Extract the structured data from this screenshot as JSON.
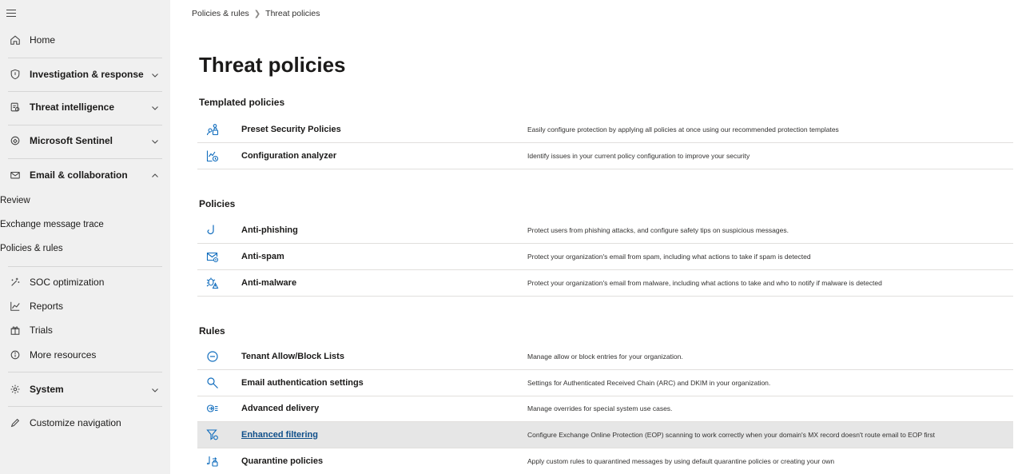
{
  "sidebar": {
    "items": [
      {
        "label": "Home",
        "icon": "home-icon"
      },
      {
        "label": "Investigation & response",
        "icon": "shield-icon"
      },
      {
        "label": "Threat intelligence",
        "icon": "threat-intel-icon"
      },
      {
        "label": "Microsoft Sentinel",
        "icon": "sentinel-icon"
      },
      {
        "label": "Email & collaboration",
        "icon": "mail-icon"
      },
      {
        "label": "SOC optimization",
        "icon": "soc-optimization-icon"
      },
      {
        "label": "Reports",
        "icon": "chart-icon"
      },
      {
        "label": "Trials",
        "icon": "gift-icon"
      },
      {
        "label": "More resources",
        "icon": "info-icon"
      },
      {
        "label": "System",
        "icon": "gear-icon"
      },
      {
        "label": "Customize navigation",
        "icon": "pencil-icon"
      }
    ],
    "sub_items": [
      "Review",
      "Exchange message trace",
      "Policies & rules"
    ]
  },
  "breadcrumb": {
    "parent": "Policies & rules",
    "current": "Threat policies"
  },
  "page": {
    "title": "Threat policies"
  },
  "sections": {
    "templated": {
      "title": "Templated policies",
      "rows": [
        {
          "name": "Preset Security Policies",
          "description": "Easily configure protection by applying all policies at once using our recommended protection templates",
          "icon": "preset-security-icon"
        },
        {
          "name": "Configuration analyzer",
          "description": "Identify issues in your current policy configuration to improve your security",
          "icon": "config-analyzer-icon"
        }
      ]
    },
    "policies": {
      "title": "Policies",
      "rows": [
        {
          "name": "Anti-phishing",
          "description": "Protect users from phishing attacks, and configure safety tips on suspicious messages.",
          "icon": "fishhook-icon"
        },
        {
          "name": "Anti-spam",
          "description": "Protect your organization's email from spam, including what actions to take if spam is detected",
          "icon": "mail-shield-icon"
        },
        {
          "name": "Anti-malware",
          "description": "Protect your organization's email from malware, including what actions to take and who to notify if malware is detected",
          "icon": "bug-warning-icon"
        }
      ]
    },
    "rules": {
      "title": "Rules",
      "rows": [
        {
          "name": "Tenant Allow/Block Lists",
          "description": "Manage allow or block entries for your organization.",
          "icon": "block-icon"
        },
        {
          "name": "Email authentication settings",
          "description": "Settings for Authenticated Received Chain (ARC) and DKIM in your organization.",
          "icon": "key-search-icon"
        },
        {
          "name": "Advanced delivery",
          "description": "Manage overrides for special system use cases.",
          "icon": "delivery-icon"
        },
        {
          "name": "Enhanced filtering",
          "description": "Configure Exchange Online Protection (EOP) scanning to work correctly when your domain's MX record doesn't route email to EOP first",
          "icon": "filter-settings-icon"
        },
        {
          "name": "Quarantine policies",
          "description": "Apply custom rules to quarantined messages by using default quarantine policies or creating your own",
          "icon": "quarantine-icon"
        }
      ]
    }
  },
  "colors": {
    "sidebar_bg": "#f0f0f0",
    "accent_icon": "#0f6cbd",
    "link": "#0f4f8a",
    "highlight_row": "#e6e6e6"
  }
}
